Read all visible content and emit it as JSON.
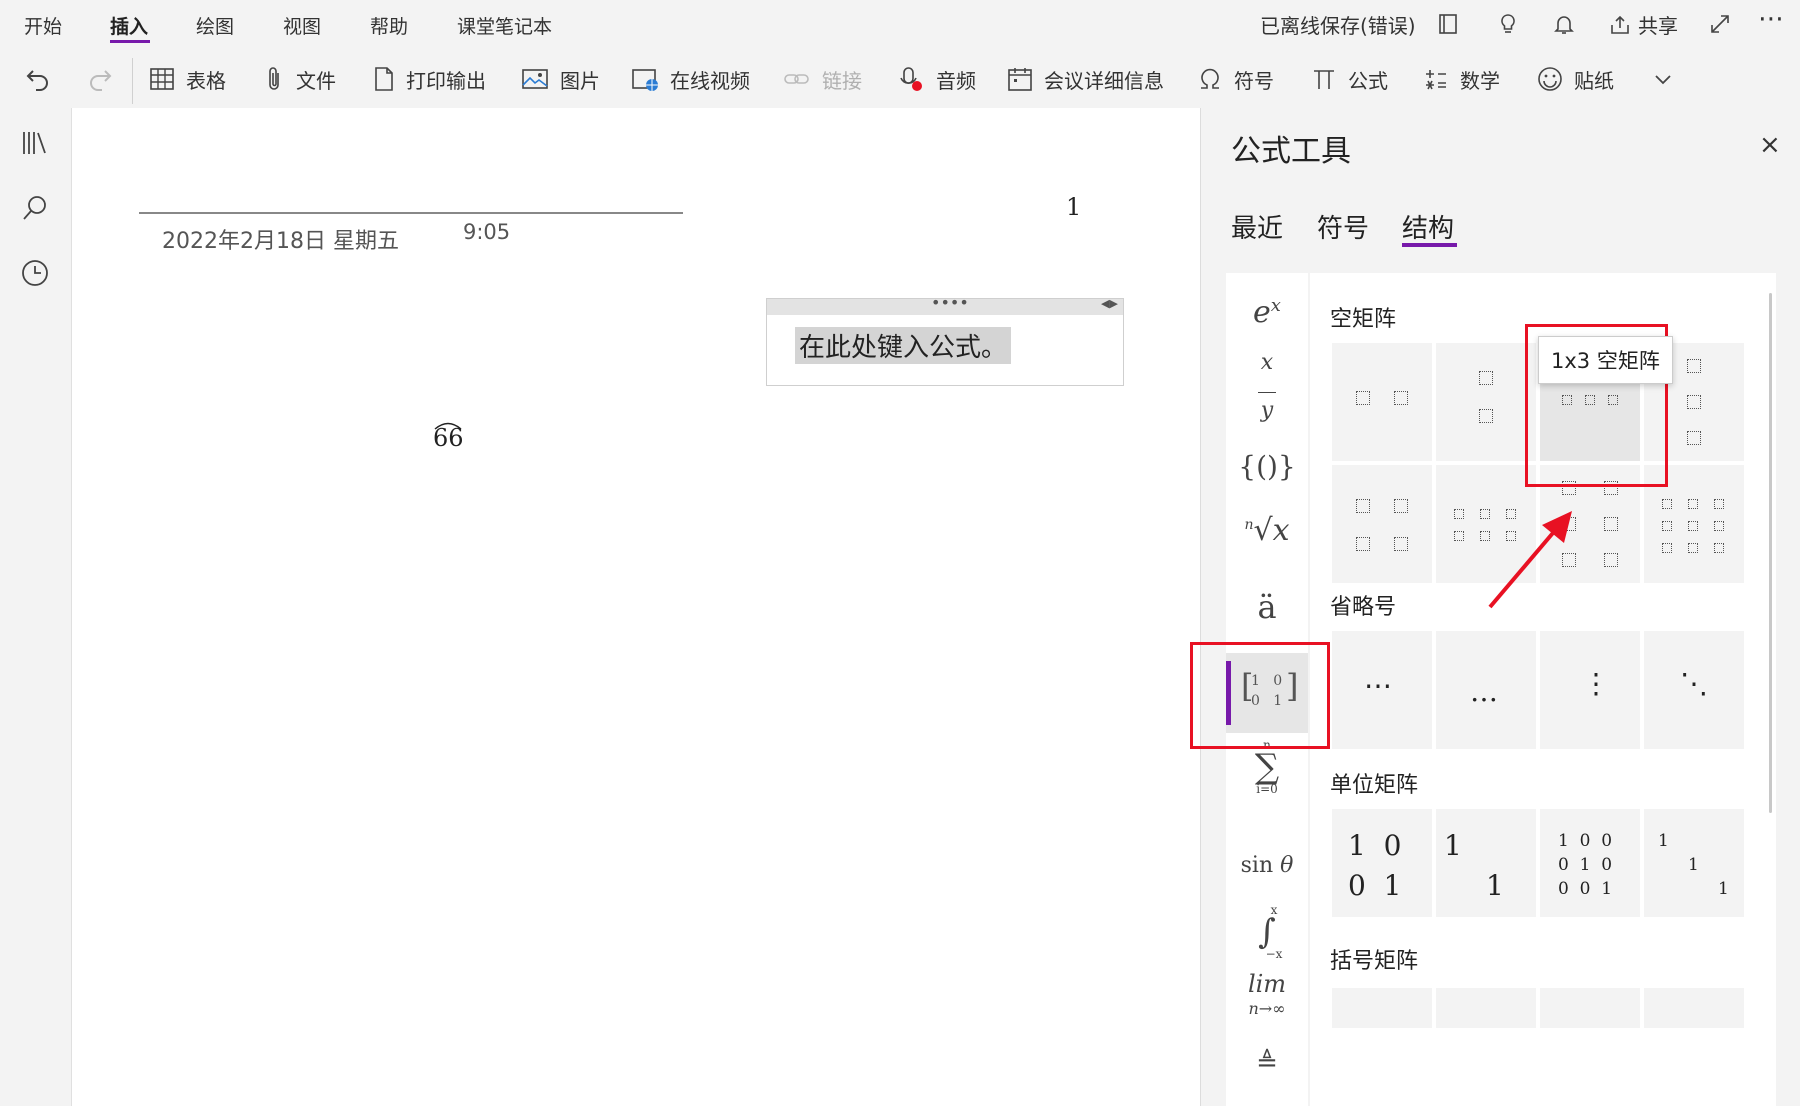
{
  "menu": {
    "tabs": [
      "开始",
      "插入",
      "绘图",
      "视图",
      "帮助",
      "课堂笔记本"
    ],
    "active_tab": "插入",
    "status": "已离线保存(错误)",
    "share_label": "共享"
  },
  "ribbon": {
    "table": "表格",
    "file": "文件",
    "printout": "打印输出",
    "picture": "图片",
    "online_video": "在线视频",
    "link": "链接",
    "audio": "音频",
    "meeting": "会议详细信息",
    "symbol": "符号",
    "equation": "公式",
    "math": "数学",
    "sticker": "贴纸"
  },
  "page": {
    "date": "2022年2月18日 星期五",
    "time": "9:05",
    "number_label": "1",
    "arc_text": "66",
    "equation_placeholder": "在此处键入公式。"
  },
  "panel": {
    "title": "公式工具",
    "tabs": [
      "最近",
      "符号",
      "结构"
    ],
    "active_tab": "结构",
    "structures": [
      "e^x",
      "x/y",
      "{()}",
      "ⁿ√x",
      "ä",
      "[1 0; 0 1]",
      "∑",
      "sin θ",
      "∫",
      "lim n→∞",
      "≜"
    ],
    "sections": {
      "empty_matrix": "空矩阵",
      "ellipsis": "省略号",
      "identity_matrix": "单位矩阵",
      "bracket_matrix": "括号矩阵"
    },
    "tooltip": "1x3 空矩阵",
    "ellipsis_glyphs": [
      "⋯",
      "…",
      "⋮",
      "⋱"
    ]
  },
  "colors": {
    "accent": "#7719aa",
    "annotation_red": "#e81123"
  }
}
